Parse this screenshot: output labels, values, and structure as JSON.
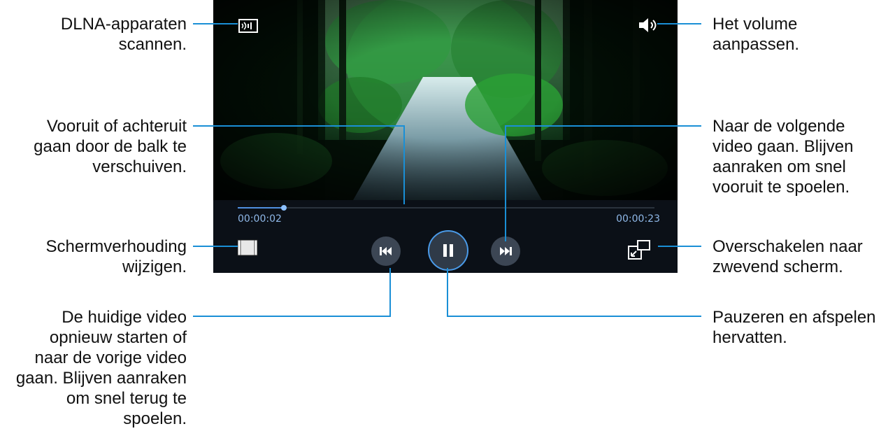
{
  "player": {
    "time_elapsed": "00:00:02",
    "time_total": "00:00:23",
    "progress_fraction": 0.11
  },
  "callouts": {
    "dlna": [
      "DLNA-apparaten",
      "scannen."
    ],
    "volume": [
      "Het volume",
      "aanpassen."
    ],
    "seek": [
      "Vooruit of achteruit",
      "gaan door de balk te",
      "verschuiven."
    ],
    "next": [
      "Naar de volgende",
      "video gaan. Blijven",
      "aanraken om snel",
      "vooruit te spoelen."
    ],
    "ratio": [
      "Schermverhouding",
      "wijzigen."
    ],
    "popup": [
      "Overschakelen naar",
      "zwevend scherm."
    ],
    "prev": [
      "De huidige video",
      "opnieuw starten of",
      "naar de vorige video",
      "gaan. Blijven aanraken",
      "om snel terug te",
      "spoelen."
    ],
    "pause": [
      "Pauzeren en afspelen",
      "hervatten."
    ]
  },
  "colors": {
    "leader_line": "#1a8fd6",
    "control_bar": "#0b1017",
    "accent": "#4f8fe0"
  },
  "icons": {
    "dlna": "dlna-scan-icon",
    "volume": "volume-icon",
    "prev": "previous-track-icon",
    "pause": "pause-icon",
    "next": "next-track-icon",
    "ratio": "screen-ratio-icon",
    "popup": "popup-player-icon"
  }
}
